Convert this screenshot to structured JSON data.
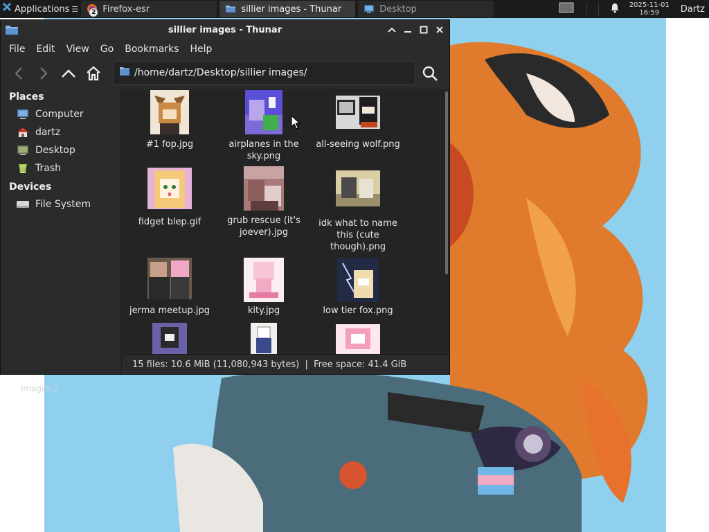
{
  "panel": {
    "apps_label": "Applications",
    "apps_menu_glyph": "☰",
    "tasks": [
      {
        "label": "Firefox-esr",
        "badge": "2",
        "icon": "firefox-icon"
      },
      {
        "label": "sillier images - Thunar",
        "icon": "folder-icon"
      },
      {
        "label": "Desktop",
        "icon": "monitor-icon"
      }
    ],
    "clock_date": "2025-11-01",
    "clock_time": "16:59",
    "user": "Dartz"
  },
  "window": {
    "title": "sillier images - Thunar",
    "menu": [
      "File",
      "Edit",
      "View",
      "Go",
      "Bookmarks",
      "Help"
    ],
    "location_path": "/home/dartz/Desktop/sillier images/",
    "sidebar": {
      "places_heading": "Places",
      "places": [
        {
          "label": "Computer",
          "icon": "computer-icon"
        },
        {
          "label": "dartz",
          "icon": "home-icon"
        },
        {
          "label": "Desktop",
          "icon": "desktop-icon"
        },
        {
          "label": "Trash",
          "icon": "trash-icon"
        }
      ],
      "devices_heading": "Devices",
      "devices": [
        {
          "label": "File System",
          "icon": "drive-icon"
        }
      ]
    },
    "files": [
      {
        "line1": "#1 fop.jpg",
        "line2": "",
        "line3": ""
      },
      {
        "line1": "airplanes in the",
        "line2": "sky.png",
        "line3": ""
      },
      {
        "line1": "all-seeing wolf.png",
        "line2": "",
        "line3": ""
      },
      {
        "line1": "fidget blep.gif",
        "line2": "",
        "line3": ""
      },
      {
        "line1": "grub rescue (it's",
        "line2": "joever).jpg",
        "line3": ""
      },
      {
        "line1": "idk what to name",
        "line2": "this (cute",
        "line3": "though).png"
      },
      {
        "line1": "jerma meetup.jpg",
        "line2": "",
        "line3": ""
      },
      {
        "line1": "kity.jpg",
        "line2": "",
        "line3": ""
      },
      {
        "line1": "low tier fox.png",
        "line2": "",
        "line3": ""
      }
    ],
    "status": "15 files: 10.6 MiB (11,080,943 bytes)  |  Free space: 41.4 GiB"
  },
  "desktop": {
    "icon_label_partial": "images 2"
  },
  "colors": {
    "panel_bg": "#1b1b1b",
    "window_bg": "#2b2b2b",
    "file_view_bg": "#242424",
    "wallpaper_sky": "#8fd0ee",
    "folder_accent": "#6b9fd4"
  }
}
